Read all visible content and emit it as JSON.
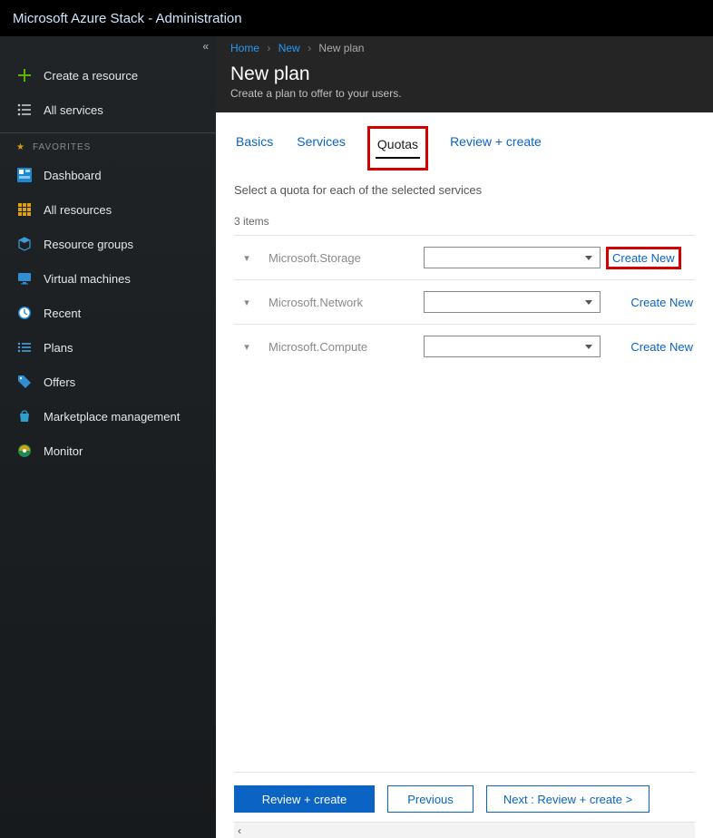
{
  "topbar": {
    "title": "Microsoft Azure Stack - Administration"
  },
  "sidebar": {
    "collapse_glyph": "«",
    "create_label": "Create a resource",
    "all_services_label": "All services",
    "favorites_heading": "FAVORITES",
    "items": [
      {
        "label": "Dashboard"
      },
      {
        "label": "All resources"
      },
      {
        "label": "Resource groups"
      },
      {
        "label": "Virtual machines"
      },
      {
        "label": "Recent"
      },
      {
        "label": "Plans"
      },
      {
        "label": "Offers"
      },
      {
        "label": "Marketplace management"
      },
      {
        "label": "Monitor"
      }
    ]
  },
  "breadcrumbs": {
    "home": "Home",
    "new": "New",
    "current": "New plan"
  },
  "header": {
    "title": "New plan",
    "subtitle": "Create a plan to offer to your users."
  },
  "tabs": {
    "basics": "Basics",
    "services": "Services",
    "quotas": "Quotas",
    "review": "Review + create"
  },
  "quotas": {
    "instruction": "Select a quota for each of the selected services",
    "count_label": "3 items",
    "create_new_label": "Create New",
    "rows": [
      {
        "service": "Microsoft.Storage"
      },
      {
        "service": "Microsoft.Network"
      },
      {
        "service": "Microsoft.Compute"
      }
    ]
  },
  "footer": {
    "review": "Review + create",
    "previous": "Previous",
    "next": "Next : Review + create >"
  }
}
